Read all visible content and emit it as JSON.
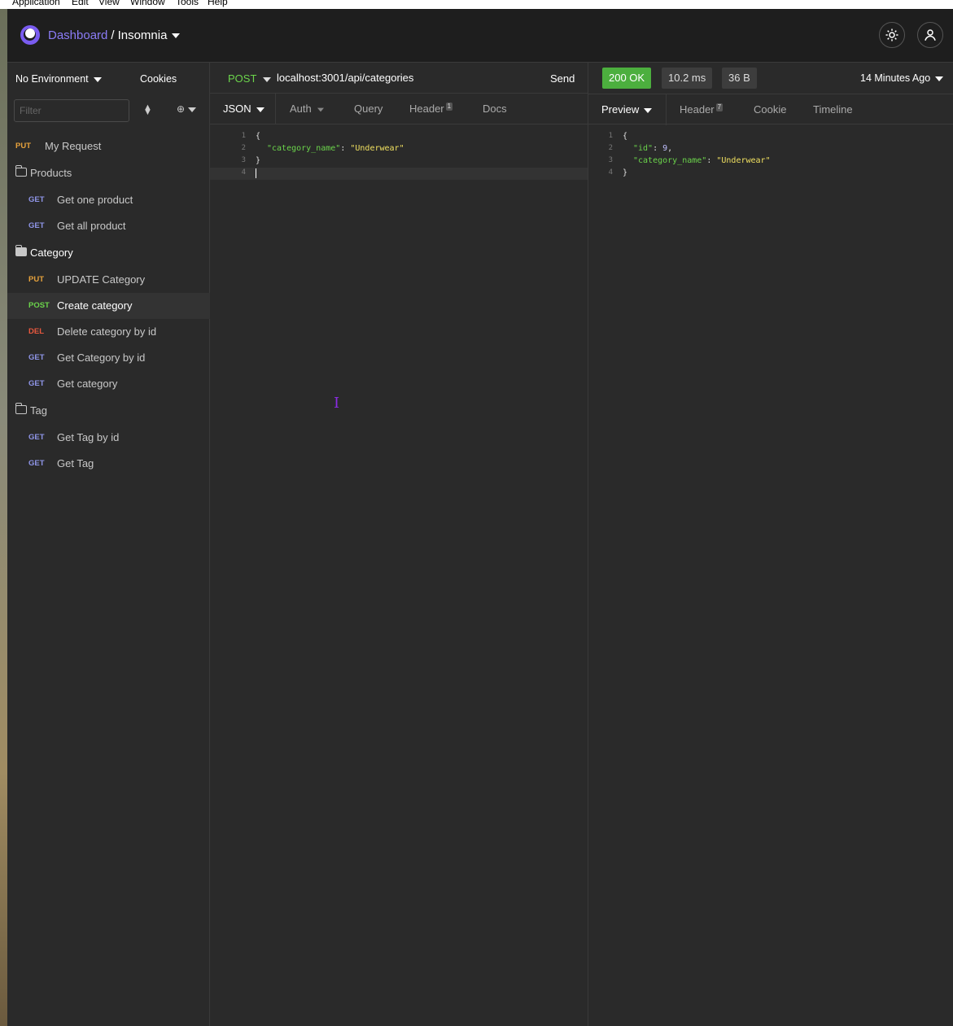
{
  "menubar": {
    "items": [
      "Application",
      "Edit",
      "View",
      "Window",
      "Tools",
      "Help"
    ]
  },
  "header": {
    "dashboard": "Dashboard",
    "separator": "/",
    "project": "Insomnia"
  },
  "sidebar": {
    "environment": "No Environment",
    "cookies": "Cookies",
    "filter_placeholder": "Filter",
    "items": [
      {
        "kind": "request",
        "method": "PUT",
        "name": "My Request"
      },
      {
        "kind": "folder",
        "name": "Products"
      },
      {
        "kind": "request",
        "method": "GET",
        "name": "Get one product"
      },
      {
        "kind": "request",
        "method": "GET",
        "name": "Get all product"
      },
      {
        "kind": "folder",
        "name": "Category"
      },
      {
        "kind": "request",
        "method": "PUT",
        "name": "UPDATE Category"
      },
      {
        "kind": "request",
        "method": "POST",
        "name": "Create category"
      },
      {
        "kind": "request",
        "method": "DEL",
        "name": "Delete category by id"
      },
      {
        "kind": "request",
        "method": "GET",
        "name": "Get Category by id"
      },
      {
        "kind": "request",
        "method": "GET",
        "name": "Get category"
      },
      {
        "kind": "folder",
        "name": "Tag"
      },
      {
        "kind": "request",
        "method": "GET",
        "name": "Get Tag by id"
      },
      {
        "kind": "request",
        "method": "GET",
        "name": "Get Tag"
      }
    ]
  },
  "request": {
    "method": "POST",
    "url": "localhost:3001/api/categories",
    "send": "Send",
    "tabs": {
      "body": "JSON",
      "auth": "Auth",
      "query": "Query",
      "header": "Header",
      "header_count": "1",
      "docs": "Docs"
    },
    "body_lines": [
      "1",
      "2",
      "3",
      "4"
    ],
    "body": {
      "open": "{",
      "key": "\"category_name\"",
      "colon": ": ",
      "value": "\"Underwear\"",
      "close": "}"
    }
  },
  "response": {
    "status": "200 OK",
    "time": "10.2 ms",
    "size": "36 B",
    "ago": "14 Minutes Ago",
    "tabs": {
      "preview": "Preview",
      "header": "Header",
      "header_count": "7",
      "cookie": "Cookie",
      "timeline": "Timeline"
    },
    "body": {
      "open": "{",
      "key1": "\"id\"",
      "val1": "9",
      "key2": "\"category_name\"",
      "val2": "\"Underwear\"",
      "close": "}"
    }
  }
}
